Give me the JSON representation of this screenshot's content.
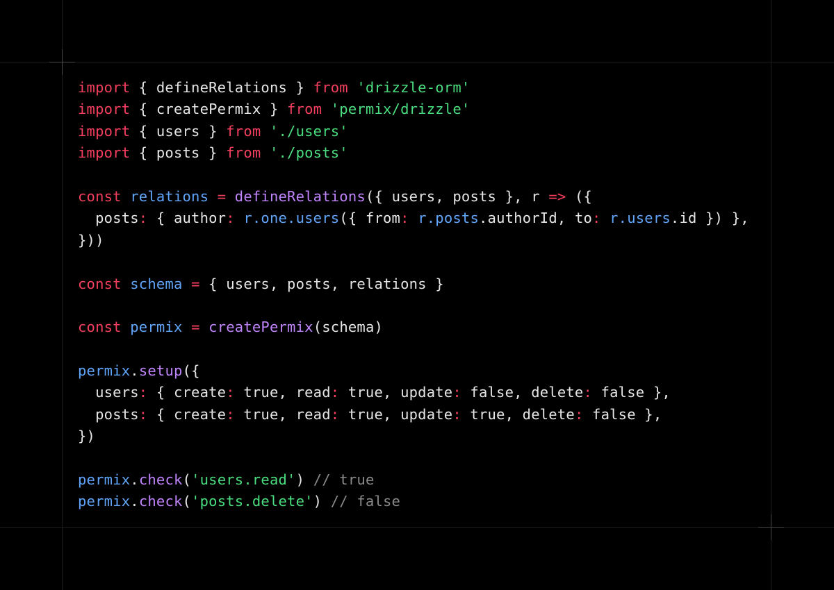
{
  "colors": {
    "background": "#000000",
    "keyword": "#f43f5e",
    "string": "#4ade80",
    "identifier": "#60a5fa",
    "function": "#c084fc",
    "plain": "#e6e6e6",
    "comment": "#8a8a8a",
    "guide": "#1e1e1e"
  },
  "code": {
    "lines": [
      [
        {
          "t": "import",
          "c": "kw"
        },
        {
          "t": " { defineRelations } ",
          "c": "pl"
        },
        {
          "t": "from",
          "c": "kw"
        },
        {
          "t": " ",
          "c": "pl"
        },
        {
          "t": "'drizzle-orm'",
          "c": "str"
        }
      ],
      [
        {
          "t": "import",
          "c": "kw"
        },
        {
          "t": " { createPermix } ",
          "c": "pl"
        },
        {
          "t": "from",
          "c": "kw"
        },
        {
          "t": " ",
          "c": "pl"
        },
        {
          "t": "'permix/drizzle'",
          "c": "str"
        }
      ],
      [
        {
          "t": "import",
          "c": "kw"
        },
        {
          "t": " { users } ",
          "c": "pl"
        },
        {
          "t": "from",
          "c": "kw"
        },
        {
          "t": " ",
          "c": "pl"
        },
        {
          "t": "'./users'",
          "c": "str"
        }
      ],
      [
        {
          "t": "import",
          "c": "kw"
        },
        {
          "t": " { posts } ",
          "c": "pl"
        },
        {
          "t": "from",
          "c": "kw"
        },
        {
          "t": " ",
          "c": "pl"
        },
        {
          "t": "'./posts'",
          "c": "str"
        }
      ],
      [],
      [
        {
          "t": "const",
          "c": "kw"
        },
        {
          "t": " ",
          "c": "pl"
        },
        {
          "t": "relations",
          "c": "var"
        },
        {
          "t": " ",
          "c": "pl"
        },
        {
          "t": "=",
          "c": "op"
        },
        {
          "t": " ",
          "c": "pl"
        },
        {
          "t": "defineRelations",
          "c": "fn"
        },
        {
          "t": "({ users, posts }, r ",
          "c": "pl"
        },
        {
          "t": "=>",
          "c": "op"
        },
        {
          "t": " ({",
          "c": "pl"
        }
      ],
      [
        {
          "t": "  posts",
          "c": "pl"
        },
        {
          "t": ":",
          "c": "op"
        },
        {
          "t": " { author",
          "c": "pl"
        },
        {
          "t": ":",
          "c": "op"
        },
        {
          "t": " ",
          "c": "pl"
        },
        {
          "t": "r.one.users",
          "c": "var"
        },
        {
          "t": "({ from",
          "c": "pl"
        },
        {
          "t": ":",
          "c": "op"
        },
        {
          "t": " ",
          "c": "pl"
        },
        {
          "t": "r.posts",
          "c": "var"
        },
        {
          "t": ".authorId, to",
          "c": "pl"
        },
        {
          "t": ":",
          "c": "op"
        },
        {
          "t": " ",
          "c": "pl"
        },
        {
          "t": "r.users",
          "c": "var"
        },
        {
          "t": ".id }) },",
          "c": "pl"
        }
      ],
      [
        {
          "t": "}))",
          "c": "pl"
        }
      ],
      [],
      [
        {
          "t": "const",
          "c": "kw"
        },
        {
          "t": " ",
          "c": "pl"
        },
        {
          "t": "schema",
          "c": "var"
        },
        {
          "t": " ",
          "c": "pl"
        },
        {
          "t": "=",
          "c": "op"
        },
        {
          "t": " { users, posts, relations }",
          "c": "pl"
        }
      ],
      [],
      [
        {
          "t": "const",
          "c": "kw"
        },
        {
          "t": " ",
          "c": "pl"
        },
        {
          "t": "permix",
          "c": "var"
        },
        {
          "t": " ",
          "c": "pl"
        },
        {
          "t": "=",
          "c": "op"
        },
        {
          "t": " ",
          "c": "pl"
        },
        {
          "t": "createPermix",
          "c": "fn"
        },
        {
          "t": "(schema)",
          "c": "pl"
        }
      ],
      [],
      [
        {
          "t": "permix",
          "c": "var"
        },
        {
          "t": ".",
          "c": "pl"
        },
        {
          "t": "setup",
          "c": "fn"
        },
        {
          "t": "({",
          "c": "pl"
        }
      ],
      [
        {
          "t": "  users",
          "c": "pl"
        },
        {
          "t": ":",
          "c": "op"
        },
        {
          "t": " { create",
          "c": "pl"
        },
        {
          "t": ":",
          "c": "op"
        },
        {
          "t": " true, read",
          "c": "pl"
        },
        {
          "t": ":",
          "c": "op"
        },
        {
          "t": " true, update",
          "c": "pl"
        },
        {
          "t": ":",
          "c": "op"
        },
        {
          "t": " false, delete",
          "c": "pl"
        },
        {
          "t": ":",
          "c": "op"
        },
        {
          "t": " false },",
          "c": "pl"
        }
      ],
      [
        {
          "t": "  posts",
          "c": "pl"
        },
        {
          "t": ":",
          "c": "op"
        },
        {
          "t": " { create",
          "c": "pl"
        },
        {
          "t": ":",
          "c": "op"
        },
        {
          "t": " true, read",
          "c": "pl"
        },
        {
          "t": ":",
          "c": "op"
        },
        {
          "t": " true, update",
          "c": "pl"
        },
        {
          "t": ":",
          "c": "op"
        },
        {
          "t": " true, delete",
          "c": "pl"
        },
        {
          "t": ":",
          "c": "op"
        },
        {
          "t": " false },",
          "c": "pl"
        }
      ],
      [
        {
          "t": "})",
          "c": "pl"
        }
      ],
      [],
      [
        {
          "t": "permix",
          "c": "var"
        },
        {
          "t": ".",
          "c": "pl"
        },
        {
          "t": "check",
          "c": "fn"
        },
        {
          "t": "(",
          "c": "pl"
        },
        {
          "t": "'users.read'",
          "c": "str"
        },
        {
          "t": ") ",
          "c": "pl"
        },
        {
          "t": "// true",
          "c": "com"
        }
      ],
      [
        {
          "t": "permix",
          "c": "var"
        },
        {
          "t": ".",
          "c": "pl"
        },
        {
          "t": "check",
          "c": "fn"
        },
        {
          "t": "(",
          "c": "pl"
        },
        {
          "t": "'posts.delete'",
          "c": "str"
        },
        {
          "t": ") ",
          "c": "pl"
        },
        {
          "t": "// false",
          "c": "com"
        }
      ]
    ]
  }
}
